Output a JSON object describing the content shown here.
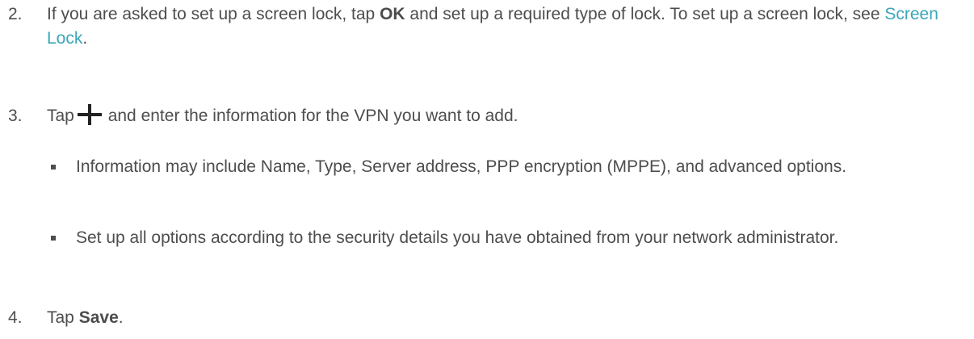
{
  "steps": [
    {
      "number": "2.",
      "part1": "If you are asked to set up a screen lock, tap ",
      "bold": "OK",
      "part2": " and set up a required type of lock. To set up a screen lock, see ",
      "link": "Screen Lock",
      "part3": "."
    },
    {
      "number": "3.",
      "before_icon": "Tap",
      "icon": "plus-icon",
      "after_icon": " and enter the information for the VPN you want to add."
    },
    {
      "number": "4.",
      "part1": "Tap ",
      "bold": "Save",
      "part2": "."
    }
  ],
  "bullets": [
    "Information may include Name, Type, Server address, PPP encryption (MPPE), and advanced options.",
    "Set up all options according to the security details you have obtained from your network administrator."
  ]
}
